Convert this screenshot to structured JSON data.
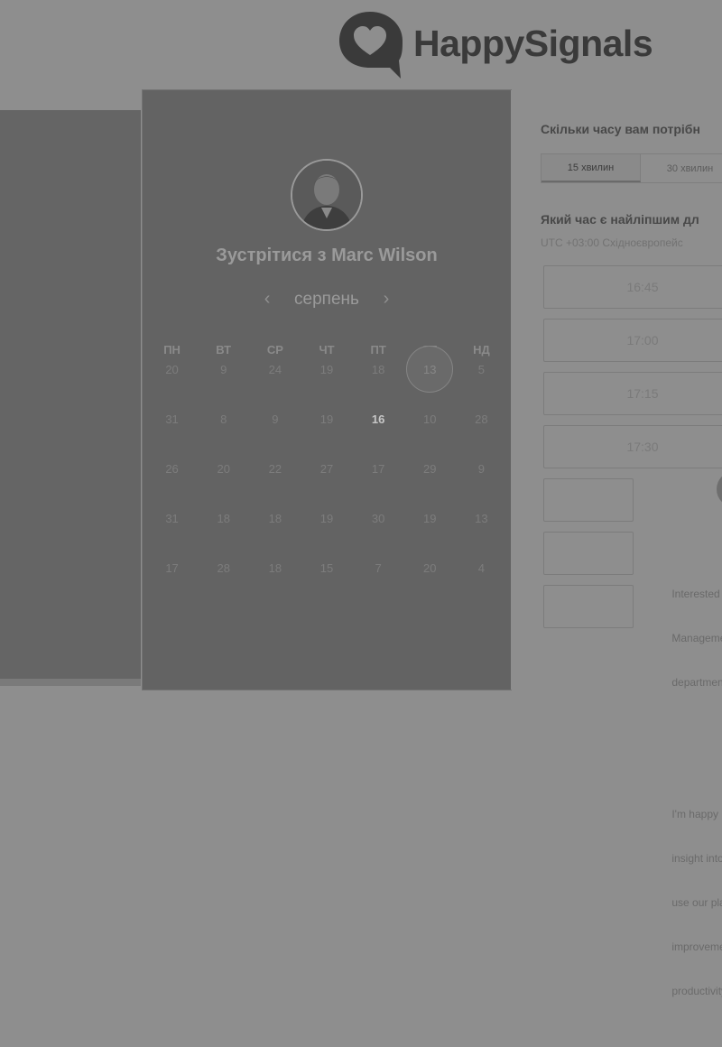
{
  "brand": {
    "name": "HappySignals"
  },
  "calendar": {
    "title": "Зустрітися з Marc Wilson",
    "month": "серпень",
    "weekdays": [
      "ПН",
      "ВТ",
      "СР",
      "ЧТ",
      "ПТ",
      "СБ",
      "НД"
    ],
    "days": [
      "20",
      "9",
      "24",
      "19",
      "18",
      "13",
      "5",
      "31",
      "8",
      "9",
      "19",
      "16",
      "10",
      "28",
      "26",
      "20",
      "22",
      "27",
      "17",
      "29",
      "9",
      "31",
      "18",
      "18",
      "19",
      "30",
      "19",
      "13",
      "17",
      "28",
      "18",
      "15",
      "7",
      "20",
      "4"
    ],
    "selected_index": 5,
    "today_index": 11
  },
  "booking": {
    "duration_question": "Скільки часу вам потрібн",
    "duration_options": [
      "15 хвилин",
      "30 хвилин"
    ],
    "active_duration": 0,
    "time_question": "Який час є найліпшим дл",
    "timezone": "UTC +03:00 Східноєвропейс",
    "slots": [
      "16:45",
      "17:00",
      "17:15",
      "17:30",
      "",
      "",
      ""
    ]
  },
  "info": {
    "paragraph1": [
      "Interested",
      "Manageme",
      "departmen"
    ],
    "paragraph2": [
      "I'm happy",
      "insight into",
      "use our pla",
      "improveme",
      "productivity"
    ]
  }
}
